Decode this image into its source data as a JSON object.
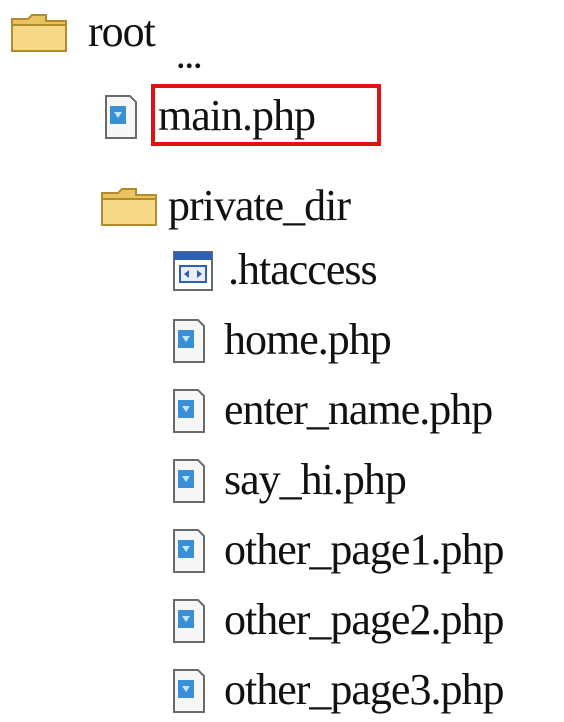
{
  "tree": {
    "root": {
      "label": "root",
      "icon": "folder-icon"
    },
    "parent_link": {
      "label": "..."
    },
    "files": [
      {
        "label": "main.php",
        "icon": "php-file-icon",
        "highlighted": true
      }
    ],
    "private_dir": {
      "label": "private_dir",
      "icon": "folder-icon",
      "children": [
        {
          "label": ".htaccess",
          "icon": "config-file-icon"
        },
        {
          "label": "home.php",
          "icon": "php-file-icon"
        },
        {
          "label": "enter_name.php",
          "icon": "php-file-icon"
        },
        {
          "label": "say_hi.php",
          "icon": "php-file-icon"
        },
        {
          "label": "other_page1.php",
          "icon": "php-file-icon"
        },
        {
          "label": "other_page2.php",
          "icon": "php-file-icon"
        },
        {
          "label": "other_page3.php",
          "icon": "php-file-icon"
        }
      ]
    }
  },
  "colors": {
    "highlight_border": "#e31212",
    "folder_yellow": "#f3d27a",
    "php_icon_blue": "#3a8fd6"
  }
}
